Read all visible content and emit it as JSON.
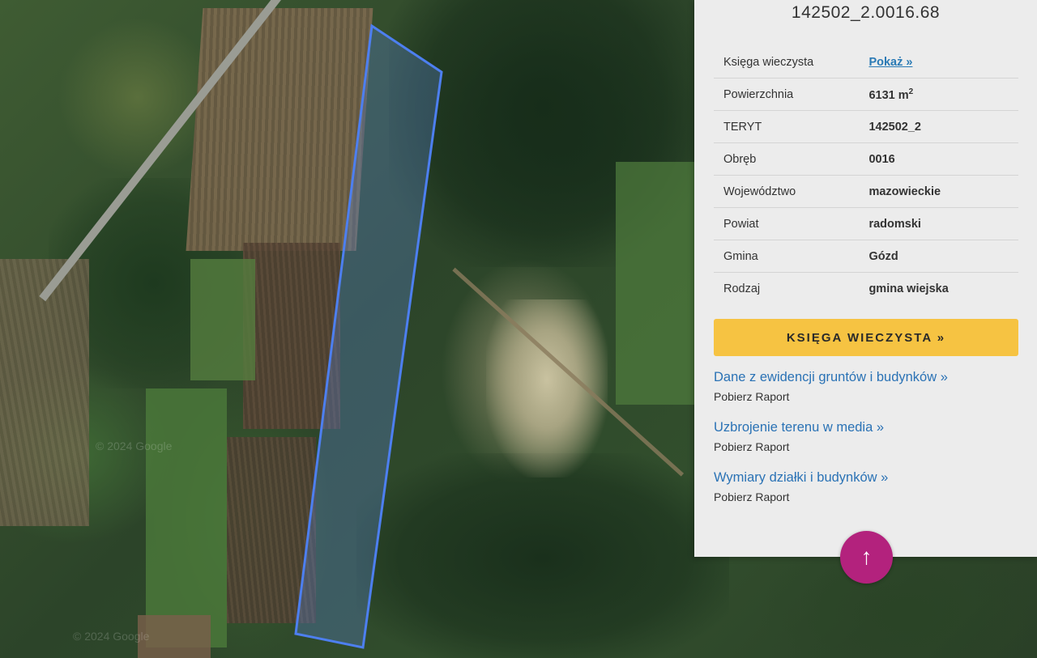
{
  "panel": {
    "parcel_id": "142502_2.0016.68",
    "rows": [
      {
        "label": "Księga wieczysta",
        "value": "Pokaż »",
        "is_link": true
      },
      {
        "label": "Powierzchnia",
        "value": "6131 m",
        "sup": "2"
      },
      {
        "label": "TERYT",
        "value": "142502_2"
      },
      {
        "label": "Obręb",
        "value": "0016"
      },
      {
        "label": "Województwo",
        "value": "mazowieckie"
      },
      {
        "label": "Powiat",
        "value": "radomski"
      },
      {
        "label": "Gmina",
        "value": "Gózd"
      },
      {
        "label": "Rodzaj",
        "value": "gmina wiejska"
      }
    ],
    "kw_button": "KSIĘGA WIECZYSTA »",
    "reports": [
      {
        "title": "Dane z ewidencji gruntów i budynków »",
        "sub": "Pobierz Raport"
      },
      {
        "title": "Uzbrojenie terenu w media »",
        "sub": "Pobierz Raport"
      },
      {
        "title": "Wymiary działki i budynków »",
        "sub": "Pobierz Raport"
      }
    ]
  },
  "scroll_top": {
    "icon": "arrow-up-icon",
    "glyph": "↑"
  },
  "map": {
    "watermark_1": "© 2024 Google",
    "watermark_2": "© 2024 Google"
  },
  "colors": {
    "parcel_outline": "#4d7ff0",
    "button_accent": "#f6c342",
    "link": "#2a72b5",
    "scroll_top": "#b3227d"
  }
}
